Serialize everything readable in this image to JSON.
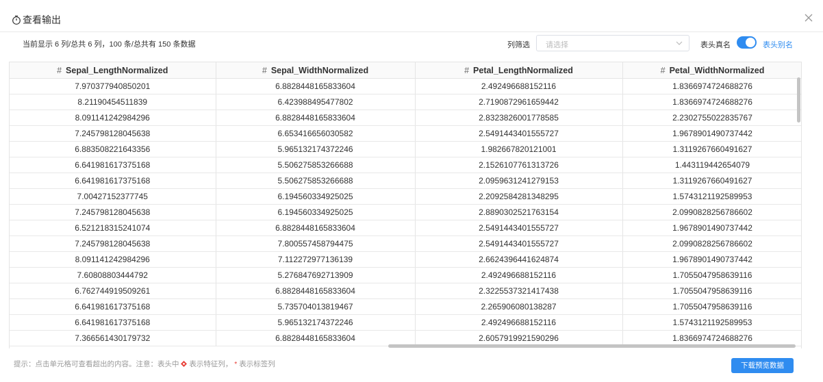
{
  "dialog": {
    "title": "查看输出",
    "summary": "当前显示 6 列/总共 6 列，100 条/总共有 150 条数据",
    "filter_label": "列筛选",
    "filter_placeholder": "请选择",
    "real_name_label": "表头真名",
    "alias_label": "表头别名",
    "alias_toggle_on": true,
    "hint_prefix": "提示：点击单元格可查看超出的内容。注意：表头中",
    "hint_feature": "表示特征列，",
    "hint_star": "*",
    "hint_label": "表示标签列",
    "download_label": "下载预览数据"
  },
  "table": {
    "hash": "#",
    "columns": [
      "Sepal_LengthNormalized",
      "Sepal_WidthNormalized",
      "Petal_LengthNormalized",
      "Petal_WidthNormalized"
    ],
    "rows": [
      [
        "7.970377940850201",
        "6.8828448165833604",
        "2.492496688152116",
        "1.8366974724688276"
      ],
      [
        "8.21190454511839",
        "6.423988495477802",
        "2.7190872961659442",
        "1.8366974724688276"
      ],
      [
        "8.091141242984296",
        "6.8828448165833604",
        "2.8323826001778585",
        "2.2302755022835767"
      ],
      [
        "7.245798128045638",
        "6.653416656030582",
        "2.5491443401555727",
        "1.9678901490737442"
      ],
      [
        "6.883508221643356",
        "5.965132174372246",
        "1.982667820121001",
        "1.3119267660491627"
      ],
      [
        "6.641981617375168",
        "5.506275853266688",
        "2.1526107761313726",
        "1.443119442654079"
      ],
      [
        "6.641981617375168",
        "5.506275853266688",
        "2.0959631241279153",
        "1.3119267660491627"
      ],
      [
        "7.00427152377745",
        "6.194560334925025",
        "2.2092584281348295",
        "1.5743121192589953"
      ],
      [
        "7.245798128045638",
        "6.194560334925025",
        "2.8890302521763154",
        "2.0990828256786602"
      ],
      [
        "6.521218315241074",
        "6.8828448165833604",
        "2.5491443401555727",
        "1.9678901490737442"
      ],
      [
        "7.245798128045638",
        "7.800557458794475",
        "2.5491443401555727",
        "2.0990828256786602"
      ],
      [
        "8.091141242984296",
        "7.112272977136139",
        "2.6624396441624874",
        "1.9678901490737442"
      ],
      [
        "7.60808803444792",
        "5.276847692713909",
        "2.492496688152116",
        "1.7055047958639116"
      ],
      [
        "6.762744919509261",
        "6.8828448165833604",
        "2.3225537321417438",
        "1.7055047958639116"
      ],
      [
        "6.641981617375168",
        "5.735704013819467",
        "2.265906080138287",
        "1.7055047958639116"
      ],
      [
        "6.641981617375168",
        "5.965132174372246",
        "2.492496688152116",
        "1.5743121192589953"
      ],
      [
        "7.366561430179732",
        "6.8828448165833604",
        "2.6057919921590296",
        "1.8366974724688276"
      ]
    ]
  },
  "colors": {
    "accent": "#2f8cf0",
    "label_star": "#e8413a"
  }
}
